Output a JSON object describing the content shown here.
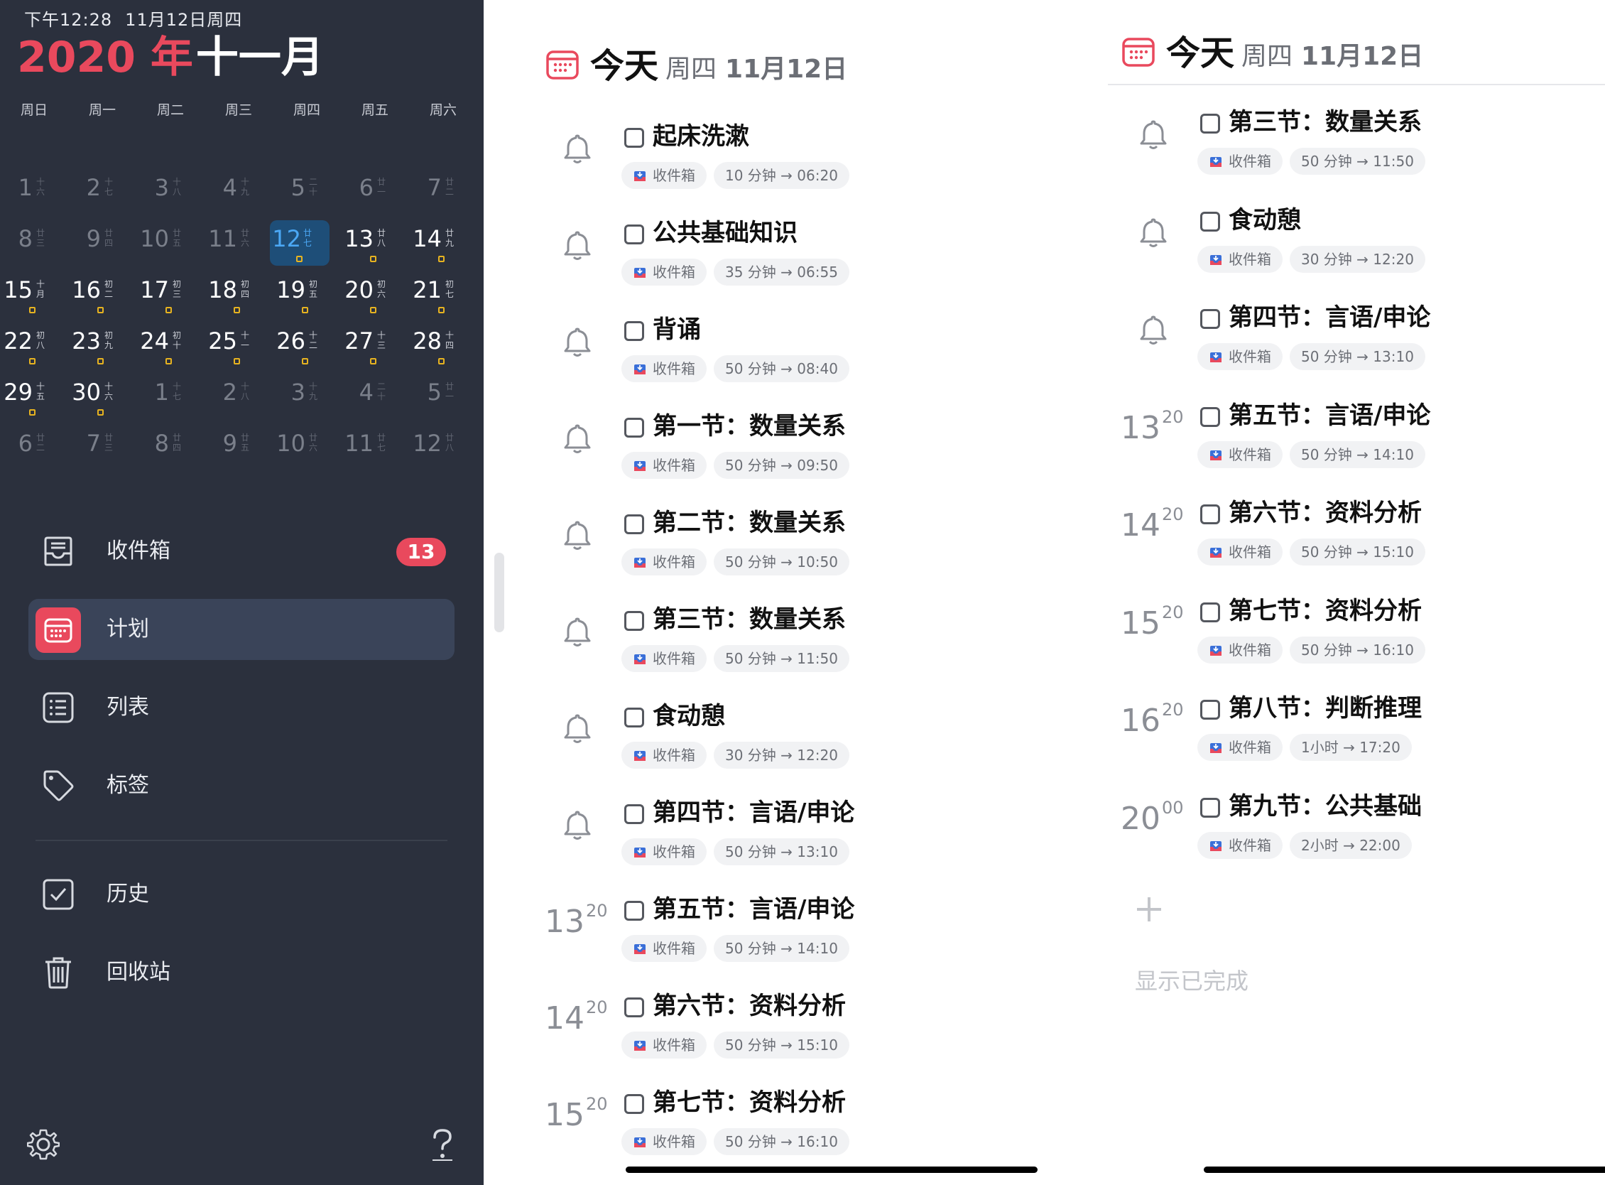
{
  "status_bar": {
    "time": "下午12:28",
    "date": "11月12日周四"
  },
  "calendar": {
    "year_label": "2020 年",
    "month_label": "十一月",
    "weekdays": [
      "周日",
      "周一",
      "周二",
      "周三",
      "周四",
      "周五",
      "周六"
    ],
    "rows": [
      [
        {
          "n": "1",
          "l": "十六",
          "dim": true
        },
        {
          "n": "2",
          "l": "十七",
          "dim": true
        },
        {
          "n": "3",
          "l": "十八",
          "dim": true
        },
        {
          "n": "4",
          "l": "十九",
          "dim": true
        },
        {
          "n": "5",
          "l": "二十",
          "dim": true
        },
        {
          "n": "6",
          "l": "廿一",
          "dim": true
        },
        {
          "n": "7",
          "l": "廿二",
          "dim": true
        }
      ],
      [
        {
          "n": "8",
          "l": "廿三",
          "dim": true
        },
        {
          "n": "9",
          "l": "廿四",
          "dim": true
        },
        {
          "n": "10",
          "l": "廿五",
          "dim": true
        },
        {
          "n": "11",
          "l": "廿六",
          "dim": true
        },
        {
          "n": "12",
          "l": "廿七",
          "today": true,
          "dot": true
        },
        {
          "n": "13",
          "l": "廿八",
          "dot": true
        },
        {
          "n": "14",
          "l": "廿九",
          "dot": true
        }
      ],
      [
        {
          "n": "15",
          "l": "十月",
          "dot": true
        },
        {
          "n": "16",
          "l": "初二",
          "dot": true
        },
        {
          "n": "17",
          "l": "初三",
          "dot": true
        },
        {
          "n": "18",
          "l": "初四",
          "dot": true
        },
        {
          "n": "19",
          "l": "初五",
          "dot": true
        },
        {
          "n": "20",
          "l": "初六",
          "dot": true
        },
        {
          "n": "21",
          "l": "初七",
          "dot": true
        }
      ],
      [
        {
          "n": "22",
          "l": "初八",
          "dot": true
        },
        {
          "n": "23",
          "l": "初九",
          "dot": true
        },
        {
          "n": "24",
          "l": "初十",
          "dot": true
        },
        {
          "n": "25",
          "l": "十一",
          "dot": true
        },
        {
          "n": "26",
          "l": "十二",
          "dot": true
        },
        {
          "n": "27",
          "l": "十三",
          "dot": true
        },
        {
          "n": "28",
          "l": "十四",
          "dot": true
        }
      ],
      [
        {
          "n": "29",
          "l": "十五",
          "dot": true
        },
        {
          "n": "30",
          "l": "十六",
          "dot": true
        },
        {
          "n": "1",
          "l": "十七",
          "dim": true
        },
        {
          "n": "2",
          "l": "十八",
          "dim": true
        },
        {
          "n": "3",
          "l": "十九",
          "dim": true
        },
        {
          "n": "4",
          "l": "二十",
          "dim": true
        },
        {
          "n": "5",
          "l": "廿一",
          "dim": true
        }
      ],
      [
        {
          "n": "6",
          "l": "廿二",
          "dim": true
        },
        {
          "n": "7",
          "l": "廿三",
          "dim": true
        },
        {
          "n": "8",
          "l": "廿四",
          "dim": true
        },
        {
          "n": "9",
          "l": "廿五",
          "dim": true
        },
        {
          "n": "10",
          "l": "廿六",
          "dim": true
        },
        {
          "n": "11",
          "l": "廿七",
          "dim": true
        },
        {
          "n": "12",
          "l": "廿八",
          "dim": true
        }
      ]
    ]
  },
  "nav": {
    "inbox": {
      "label": "收件箱",
      "badge": "13",
      "icon": "inbox-icon"
    },
    "plan": {
      "label": "计划",
      "icon": "calendar-icon"
    },
    "list": {
      "label": "列表",
      "icon": "list-icon"
    },
    "tags": {
      "label": "标签",
      "icon": "tag-icon"
    },
    "history": {
      "label": "历史",
      "icon": "checkbox-icon"
    },
    "trash": {
      "label": "回收站",
      "icon": "trash-icon"
    }
  },
  "bottom": {
    "settings_icon": "gear-icon",
    "help_icon": "question-icon"
  },
  "colors": {
    "accent": "#e9495d",
    "sidebar_bg": "#2b303d",
    "today_bg": "#1e4e78",
    "dot": "#e7b320"
  },
  "header": {
    "title": "今天",
    "weekday": "周四",
    "date": "11月12日"
  },
  "pane1_tasks": [
    {
      "title": "起床洗漱",
      "list": "收件箱",
      "duration": "10 分钟 → 06:20",
      "lead": "bell"
    },
    {
      "title": "公共基础知识",
      "list": "收件箱",
      "duration": "35 分钟 → 06:55",
      "lead": "bell"
    },
    {
      "title": "背诵",
      "list": "收件箱",
      "duration": "50 分钟 → 08:40",
      "lead": "bell"
    },
    {
      "title": "第一节：数量关系",
      "list": "收件箱",
      "duration": "50 分钟 → 09:50",
      "lead": "bell"
    },
    {
      "title": "第二节：数量关系",
      "list": "收件箱",
      "duration": "50 分钟 → 10:50",
      "lead": "bell"
    },
    {
      "title": "第三节：数量关系",
      "list": "收件箱",
      "duration": "50 分钟 → 11:50",
      "lead": "bell"
    },
    {
      "title": "食动憩",
      "list": "收件箱",
      "duration": "30 分钟 → 12:20",
      "lead": "bell"
    },
    {
      "title": "第四节：言语/申论",
      "list": "收件箱",
      "duration": "50 分钟 → 13:10",
      "lead": "bell"
    },
    {
      "title": "第五节：言语/申论",
      "list": "收件箱",
      "duration": "50 分钟 → 14:10",
      "lead": "time",
      "hour": "13",
      "min": "20"
    },
    {
      "title": "第六节：资料分析",
      "list": "收件箱",
      "duration": "50 分钟 → 15:10",
      "lead": "time",
      "hour": "14",
      "min": "20"
    },
    {
      "title": "第七节：资料分析",
      "list": "收件箱",
      "duration": "50 分钟 → 16:10",
      "lead": "time",
      "hour": "15",
      "min": "20"
    }
  ],
  "pane2_tasks": [
    {
      "title": "第三节：数量关系",
      "list": "收件箱",
      "duration": "50 分钟 → 11:50",
      "lead": "bell"
    },
    {
      "title": "食动憩",
      "list": "收件箱",
      "duration": "30 分钟 → 12:20",
      "lead": "bell"
    },
    {
      "title": "第四节：言语/申论",
      "list": "收件箱",
      "duration": "50 分钟 → 13:10",
      "lead": "bell"
    },
    {
      "title": "第五节：言语/申论",
      "list": "收件箱",
      "duration": "50 分钟 → 14:10",
      "lead": "time",
      "hour": "13",
      "min": "20"
    },
    {
      "title": "第六节：资料分析",
      "list": "收件箱",
      "duration": "50 分钟 → 15:10",
      "lead": "time",
      "hour": "14",
      "min": "20"
    },
    {
      "title": "第七节：资料分析",
      "list": "收件箱",
      "duration": "50 分钟 → 16:10",
      "lead": "time",
      "hour": "15",
      "min": "20"
    },
    {
      "title": "第八节：判断推理",
      "list": "收件箱",
      "duration": "1小时 → 17:20",
      "lead": "time",
      "hour": "16",
      "min": "20"
    },
    {
      "title": "第九节：公共基础",
      "list": "收件箱",
      "duration": "2小时 → 22:00",
      "lead": "time",
      "hour": "20",
      "min": "00"
    }
  ],
  "footer": {
    "add_icon": "plus-icon",
    "show_completed": "显示已完成"
  }
}
